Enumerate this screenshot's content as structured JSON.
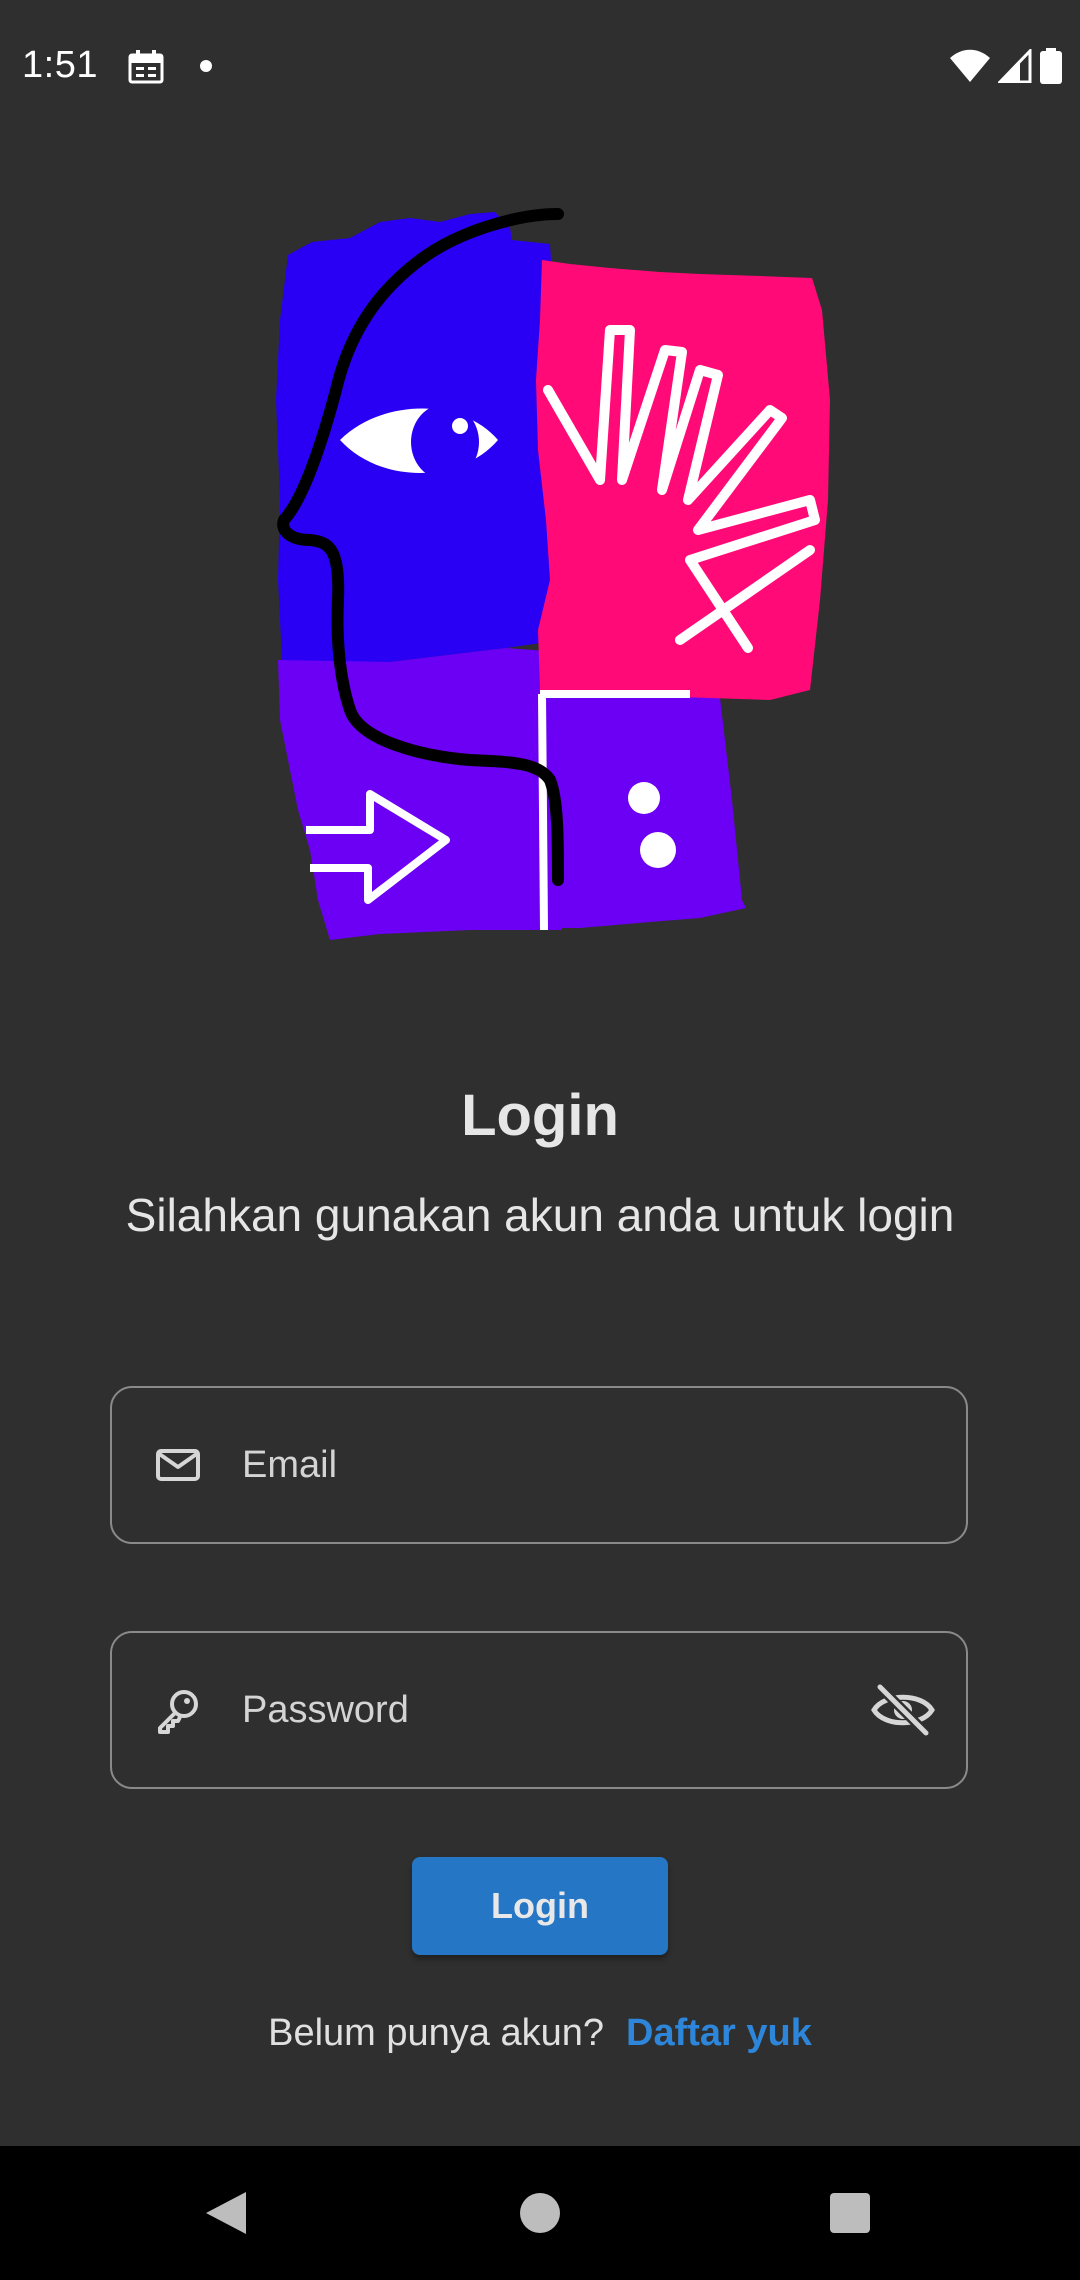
{
  "status_bar": {
    "time": "1:51",
    "icons": [
      "calendar-icon",
      "notification-dot-icon",
      "wifi-icon",
      "signal-icon",
      "battery-icon"
    ]
  },
  "logo": {
    "icon": "head-profile-logo",
    "colors": {
      "blue": "#2a00f5",
      "pink": "#ff0a77",
      "purple": "#6b00f5"
    }
  },
  "login": {
    "title": "Login",
    "subtitle": "Silahkan gunakan akun anda untuk login",
    "email": {
      "placeholder": "Email",
      "value": "",
      "icon": "mail-icon"
    },
    "password": {
      "placeholder": "Password",
      "value": "",
      "icon": "key-icon",
      "toggle_icon": "visibility-off-icon"
    },
    "button_label": "Login",
    "register_prompt": "Belum punya akun?",
    "register_link": "Daftar yuk"
  },
  "nav_bar": {
    "icons": [
      "back-icon",
      "home-icon",
      "recents-icon"
    ]
  },
  "theme": {
    "background": "#2f2f2f",
    "accent": "#2576c5",
    "link": "#2d86d9"
  }
}
